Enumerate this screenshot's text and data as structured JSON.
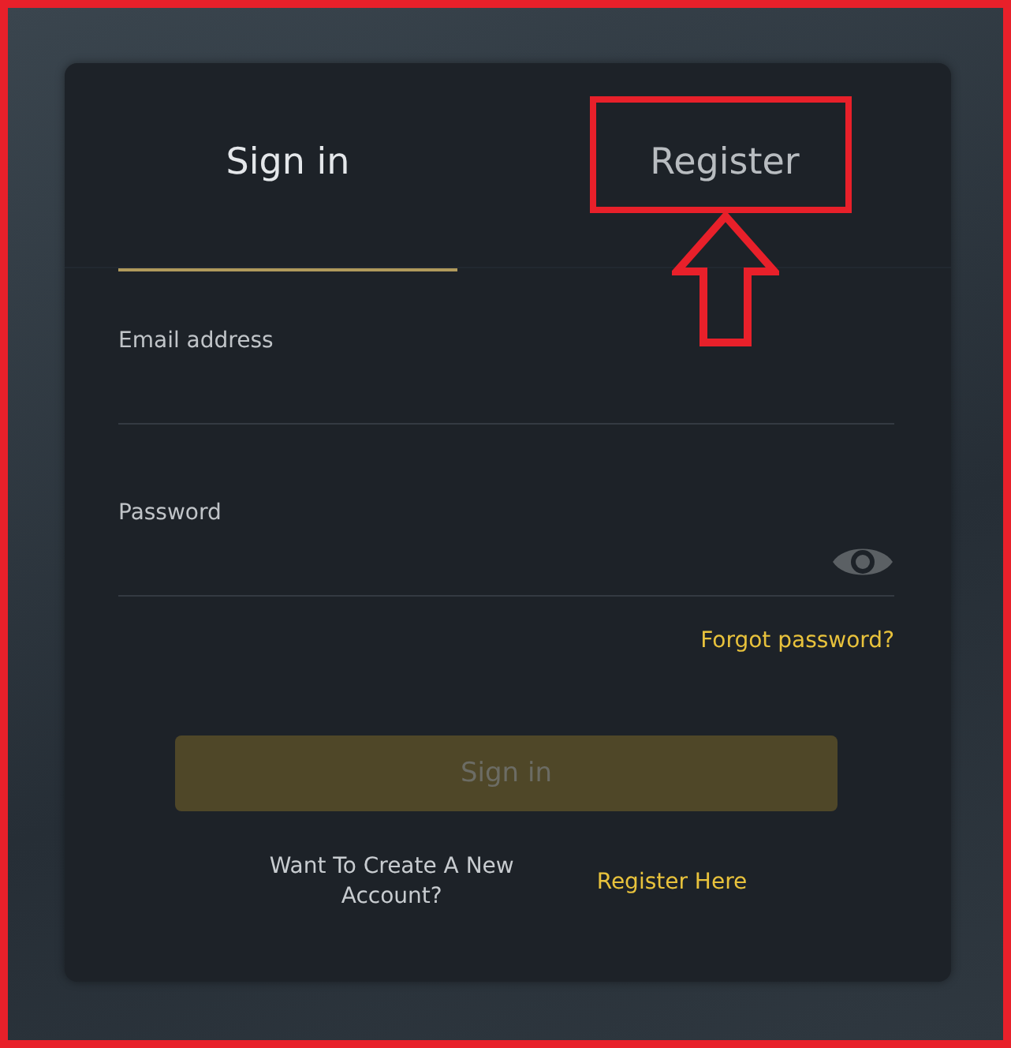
{
  "tabs": [
    {
      "label": "Sign in",
      "selected": true
    },
    {
      "label": "Register",
      "selected": false
    }
  ],
  "fields": [
    {
      "kind": "text",
      "label": "Email address"
    },
    {
      "kind": "password",
      "label": "Password"
    }
  ],
  "forgot_link": "Forgot password?",
  "submit_button": {
    "label": "Sign in",
    "disabled": true
  },
  "register_prompt": {
    "text": "Want To Create A New Account?",
    "link": "Register Here"
  }
}
